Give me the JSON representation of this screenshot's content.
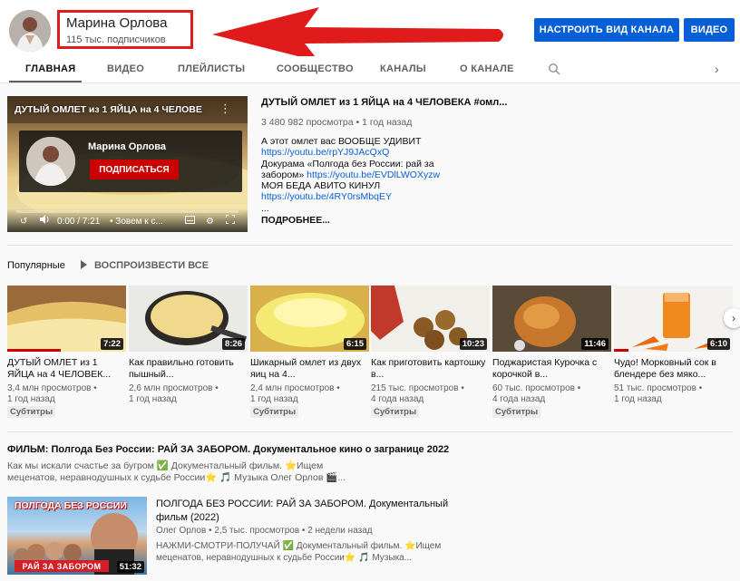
{
  "channel": {
    "name": "Марина Орлова",
    "subscribers": "115 тыс. подписчиков"
  },
  "header_buttons": {
    "customize": "НАСТРОИТЬ ВИД КАНАЛА",
    "video": "ВИДЕО"
  },
  "tabs": [
    {
      "label": "ГЛАВНАЯ",
      "active": true
    },
    {
      "label": "ВИДЕО"
    },
    {
      "label": "ПЛЕЙЛИСТЫ"
    },
    {
      "label": "СООБЩЕСТВО"
    },
    {
      "label": "КАНАЛЫ"
    },
    {
      "label": "О КАНАЛЕ"
    }
  ],
  "icons": {
    "search": "search-icon",
    "tabs_next": "chevron-right-icon",
    "shelf_next": "chevron-right-icon",
    "play": "play-icon"
  },
  "featured": {
    "thumb_title": "ДУТЫЙ ОМЛЕТ из 1 ЯЙЦА на 4 ЧЕЛОВЕ",
    "subscribe_card": {
      "name": "Марина Орлова",
      "button": "ПОДПИСАТЬСЯ"
    },
    "player_time": "0:00 / 7:21",
    "player_chapter": "• Зовем к с...",
    "progress": 0.0,
    "title": "ДУТЫЙ ОМЛЕТ из 1 ЯЙЦА на 4 ЧЕЛОВЕКА #омл...",
    "meta": "3 480 982 просмотра • 1 год назад",
    "desc_line1": "А этот омлет вас ВООБЩЕ УДИВИТ",
    "link1": "https://youtu.be/rpYJ9JAcQxQ",
    "desc_line2": "Докурама «Полгода без России: рай за",
    "desc_line3_pre": "забором» ",
    "link2": "https://youtu.be/EVDlLWOXyzw",
    "desc_line4": "МОЯ БЕДА АВИТО КИНУЛ",
    "link3": "https://youtu.be/4RY0rsMbqEY",
    "ellipsis": "...",
    "more": "ПОДРОБНЕЕ..."
  },
  "popular": {
    "title": "Популярные",
    "play_all": "ВОСПРОИЗВЕСТИ ВСЕ",
    "videos": [
      {
        "title": "ДУТЫЙ ОМЛЕТ из 1 ЯЙЦА на 4 ЧЕЛОВЕК...",
        "views": "3,4 млн просмотров •",
        "age": "1 год назад",
        "duration": "7:22",
        "badge": "Субтитры",
        "watched": 0.45
      },
      {
        "title": "Как правильно готовить пышный...",
        "views": "2,6 млн просмотров •",
        "age": "1 год назад",
        "duration": "8:26",
        "badge": "",
        "watched": 0.0
      },
      {
        "title": "Шикарный омлет из двух яиц на 4...",
        "views": "2,4 млн просмотров •",
        "age": "1 год назад",
        "duration": "6:15",
        "badge": "Субтитры",
        "watched": 0.0
      },
      {
        "title": "Как приготовить картошку в...",
        "views": "215 тыс. просмотров •",
        "age": "4 года назад",
        "duration": "10:23",
        "badge": "Субтитры",
        "watched": 0.0
      },
      {
        "title": "Поджаристая Курочка с корочкой в...",
        "views": "60 тыс. просмотров •",
        "age": "4 года назад",
        "duration": "11:46",
        "badge": "Субтитры",
        "watched": 0.0
      },
      {
        "title": "Чудо! Морковный сок в блендере без мяко...",
        "views": "51 тыс. просмотров •",
        "age": "1 год назад",
        "duration": "6:10",
        "badge": "",
        "watched": 0.12
      }
    ]
  },
  "film": {
    "shelf_title": "ФИЛЬМ: Полгода Без России: РАЙ ЗА ЗАБОРОМ. Документальное кино о загранице 2022",
    "shelf_desc": "Как мы искали счастье за бугром ✅ Документальный фильм. ⭐Ищем меценатов, неравнодушных к судьбе России⭐ 🎵 Музыка Олег Орлов 🎬...",
    "thumb_top": "ПОЛГОДА БЕЗ РОССИИ",
    "thumb_bottom": "РАЙ ЗА ЗАБОРОМ",
    "duration": "51:32",
    "video_title": "ПОЛГОДА БЕЗ РОССИИ: РАЙ ЗА ЗАБОРОМ. Документальный фильм (2022)",
    "video_meta": "Олег Орлов • 2,5 тыс. просмотров • 2 недели назад",
    "video_desc": "НАЖМИ-СМОТРИ-ПОЛУЧАЙ ✅ Документальный фильм. ⭐Ищем меценатов, неравнодушных к судьбе России⭐ 🎵 Музыка..."
  }
}
